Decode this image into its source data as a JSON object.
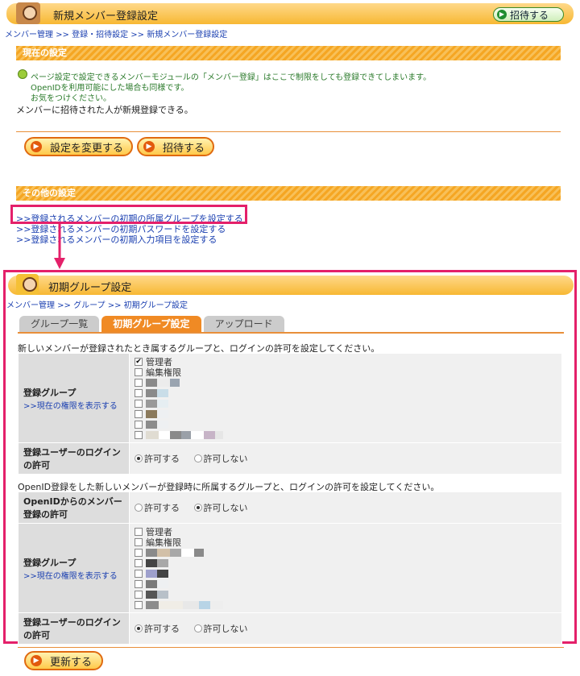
{
  "header": {
    "title": "新規メンバー登録設定",
    "invite_button": "招待する",
    "breadcrumb": "メンバー管理 >> 登録・招待設定 >> 新規メンバー登録設定"
  },
  "current_settings": {
    "heading": "現在の設定",
    "notice_line1": "ページ設定で設定できるメンバーモジュールの「メンバー登録」はここで制限をしても登録できてしまいます。",
    "notice_line2": "OpenIDを利用可能にした場合も同様です。",
    "notice_line3": "お気をつけください。",
    "status": "メンバーに招待された人が新規登録できる。",
    "change_button": "設定を変更する",
    "invite_button": "招待する"
  },
  "other_settings": {
    "heading": "その他の設定",
    "links": [
      ">>登録されるメンバーの初期の所属グループを設定する",
      ">>登録されるメンバーの初期パスワードを設定する",
      ">>登録されるメンバーの初期入力項目を設定する"
    ]
  },
  "group_panel": {
    "title": "初期グループ設定",
    "breadcrumb": "メンバー管理 >> グループ >> 初期グループ設定",
    "tabs": [
      "グループ一覧",
      "初期グループ設定",
      "アップロード"
    ],
    "section1_intro": "新しいメンバーが登録されたとき属するグループと、ログインの許可を設定してください。",
    "section2_intro": "OpenID登録をした新しいメンバーが登録時に所属するグループと、ログインの許可を設定してください。",
    "label_group": "登録グループ",
    "label_show_perm": ">>現在の権限を表示する",
    "label_login": "登録ユーザーのログインの許可",
    "label_openid": "OpenIDからのメンバー登録の許可",
    "group_admin": "管理者",
    "group_editor": "編集権限",
    "radio_allow": "許可する",
    "radio_deny": "許可しない",
    "update_button": "更新する"
  }
}
